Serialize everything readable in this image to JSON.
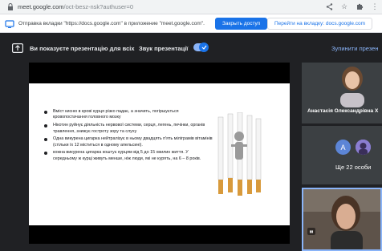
{
  "browser": {
    "url_main": "meet.google.com",
    "url_rest": "/oct-besz-nsk?authuser=0"
  },
  "share_bar": {
    "message": "Отправка вкладки \"https://docs.google.com\" в приложение \"meet.google.com\".",
    "stop_button": "Закрыть доступ",
    "goto_button": "Перейти на вкладку: docs.google.com"
  },
  "meet_bar": {
    "present_label": "Ви показуєте презентацію для всіх",
    "sound_label": "Звук презентації",
    "sound_on": true,
    "stop_label": "Зупинити презен"
  },
  "slide": {
    "bullets": [
      "Вміст кисню в крові курця різко падає, а значить, погіршується кровопостачання головного мозку",
      "Нікотин руйнує діяльність нервової системи, серця, легень, печінки, органів травлення, знижує гостроту зору та слуху",
      "Одна викурена цигарка нейтралізує в ньому двадцять п'ять міліграмів вітамінів (стільки їх 12 міститься в одному апельсині).",
      "кожна викурена цигарка коштує курцям від 5 до 15 хвилин життя. У середньому ж курці живуть менше, ніж люди, які не курять, на 6 – 8 років."
    ]
  },
  "participants": {
    "tile1_name": "Анастасія Олександрівна Х",
    "tile2_avatar": "А",
    "tile2_count": "Ще 22 особи"
  },
  "colors": {
    "accent": "#1a73e8",
    "meet_bg": "#202124",
    "link": "#8ab4f8"
  }
}
